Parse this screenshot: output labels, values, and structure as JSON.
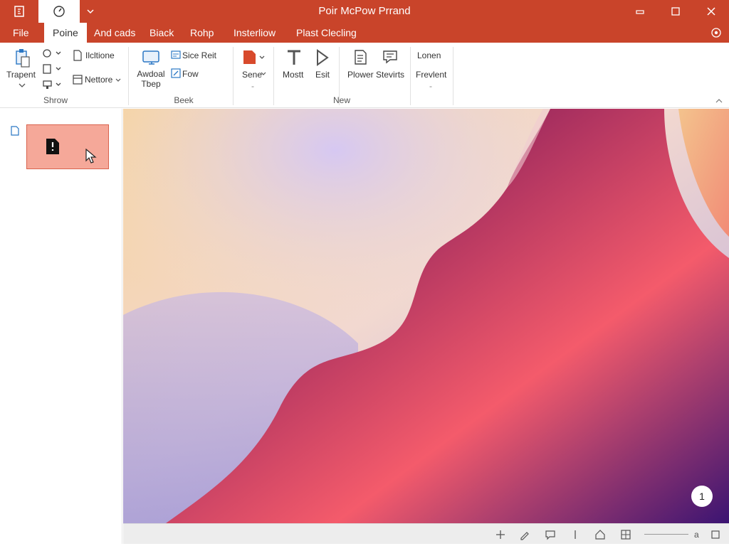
{
  "window": {
    "title": "Poir McPow Prrand",
    "accent_color": "#c9442a",
    "controls": [
      "minimize-icon",
      "maximize-icon",
      "close-icon"
    ]
  },
  "quick_access": [
    "app-logo-icon",
    "autosave-icon",
    "quick-access-dropdown-icon"
  ],
  "menu": {
    "tabs": [
      "File",
      "Poine",
      "And cads",
      "Biack",
      "Rohp",
      "Insterliow",
      "Plast Clecling"
    ],
    "active_tab": "Poine"
  },
  "ribbon": {
    "groups": [
      {
        "label": "Shrow",
        "items": [
          {
            "label": "Trapent",
            "icon": "paste-icon"
          },
          {
            "label": "",
            "icon": "refresh-icon"
          },
          {
            "label": "",
            "icon": "copy-icon"
          },
          {
            "label": "",
            "icon": "format-painter-icon"
          },
          {
            "label": "Ilcltione",
            "icon": "new-slide-icon"
          },
          {
            "label": "Nettore",
            "icon": "layout-icon"
          }
        ]
      },
      {
        "label": "Beek",
        "items": [
          {
            "label": "Awdoal Tbep",
            "icon": "monitor-icon"
          },
          {
            "label": "Sice Reit",
            "icon": "slide-reset-icon"
          },
          {
            "label": "Fow",
            "icon": "edit-icon"
          }
        ]
      },
      {
        "label": "",
        "items": [
          {
            "label": "Sene",
            "icon": "shape-fill-icon"
          }
        ]
      },
      {
        "label": "New",
        "items": [
          {
            "label": "Mostt",
            "icon": "text-icon"
          },
          {
            "label": "Esit",
            "icon": "play-icon"
          },
          {
            "label": "Plower Stevirts",
            "icon": "document-icon"
          },
          {
            "label": "",
            "icon": "comment-icon"
          }
        ]
      },
      {
        "label": "",
        "items": [
          {
            "label": "Lonen",
            "icon": ""
          },
          {
            "label": "Frevlent",
            "icon": ""
          }
        ]
      }
    ]
  },
  "slides_panel": {
    "slide_number_icon": "slide-icon",
    "thumbnail_color": "#f5a899"
  },
  "slide": {
    "badge": "1",
    "colors": [
      "#f6d7a8",
      "#c9b8e8",
      "#8c2a5c",
      "#f25a6a",
      "#3a1270"
    ]
  },
  "status_bar": {
    "icons": [
      "zoom-in-icon",
      "pen-icon",
      "comment-icon",
      "divider-icon",
      "home-icon",
      "grid-view-icon",
      "fit-icon"
    ],
    "zoom_label": "a"
  }
}
